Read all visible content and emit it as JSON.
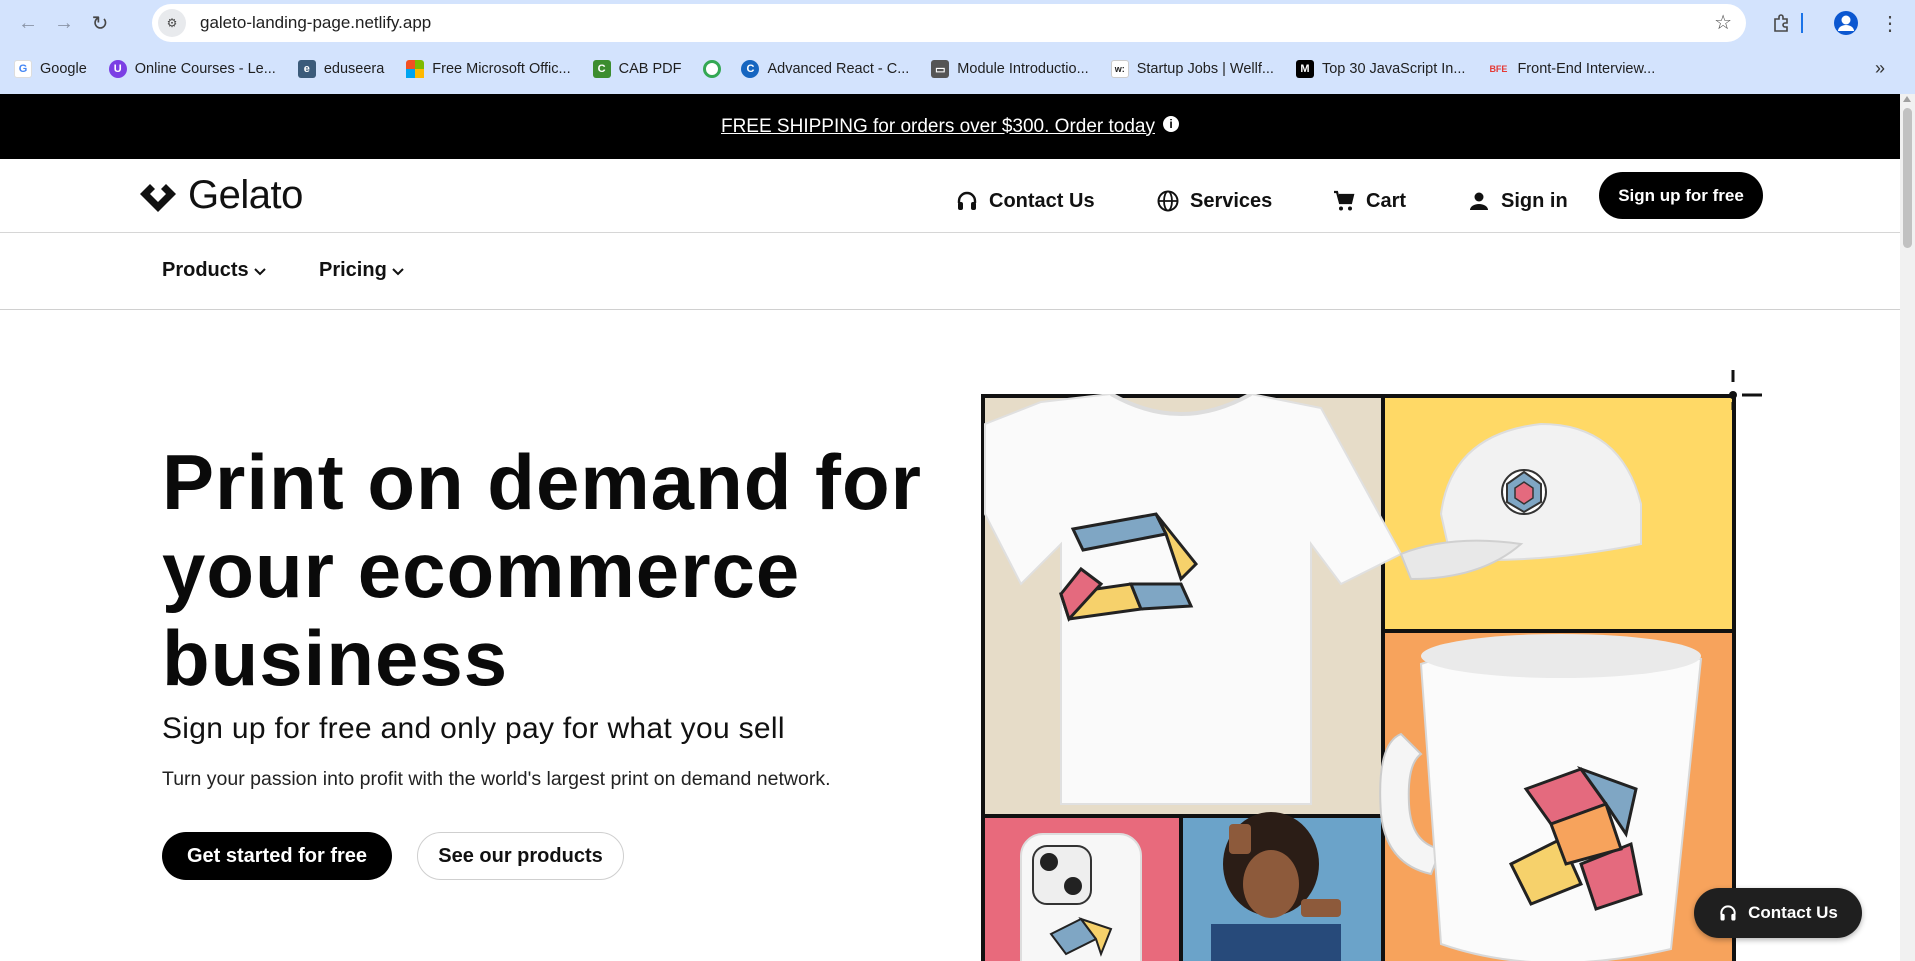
{
  "browser": {
    "url": "galeto-landing-page.netlify.app",
    "bookmarks": [
      {
        "label": "Google",
        "color": "#4285f4",
        "glyph": "G"
      },
      {
        "label": "Online Courses - Le...",
        "color": "#7b3fe4",
        "glyph": "U"
      },
      {
        "label": "eduseera",
        "color": "#3b5b7a",
        "glyph": "e"
      },
      {
        "label": "Free Microsoft Offic...",
        "color": "#f25022",
        "glyph": ""
      },
      {
        "label": "CAB PDF",
        "color": "#3c8d2f",
        "glyph": "C"
      },
      {
        "label": "",
        "color": "#f4b400",
        "glyph": "○"
      },
      {
        "label": "Advanced React - C...",
        "color": "#1565c0",
        "glyph": "C"
      },
      {
        "label": "Module Introductio...",
        "color": "#555555",
        "glyph": "▭"
      },
      {
        "label": "Startup Jobs | Wellf...",
        "color": "#222222",
        "glyph": "w:"
      },
      {
        "label": "Top 30 JavaScript In...",
        "color": "#000000",
        "glyph": "M"
      },
      {
        "label": "Front-End Interview...",
        "color": "#e53935",
        "glyph": "BFE"
      }
    ]
  },
  "promo": {
    "text": "FREE SHIPPING for orders over $300. Order today"
  },
  "header": {
    "logo_text": "Gelato",
    "nav": {
      "contact": "Contact Us",
      "services": "Services",
      "cart": "Cart",
      "signin": "Sign in"
    },
    "signup_label": "Sign up for free"
  },
  "subnav": {
    "products": "Products",
    "pricing": "Pricing"
  },
  "hero": {
    "title_line1": "Print on demand for",
    "title_line2": "your ecommerce",
    "title_line3": "business",
    "subtitle": "Sign up for free and only pay for what you sell",
    "description": "Turn your passion into profit with the world's largest print on demand network.",
    "cta_primary": "Get started for free",
    "cta_secondary": "See our products"
  },
  "floating": {
    "contact_label": "Contact Us"
  },
  "colors": {
    "tile_beige": "#e6dcc8",
    "tile_yellow": "#ffd966",
    "tile_orange": "#f7a35c",
    "tile_pink": "#e86a7c",
    "tile_blue": "#6ba3c9",
    "accent_blue": "#7fa6c4",
    "accent_yellow": "#f6d16b",
    "accent_pink": "#e46a7e"
  }
}
